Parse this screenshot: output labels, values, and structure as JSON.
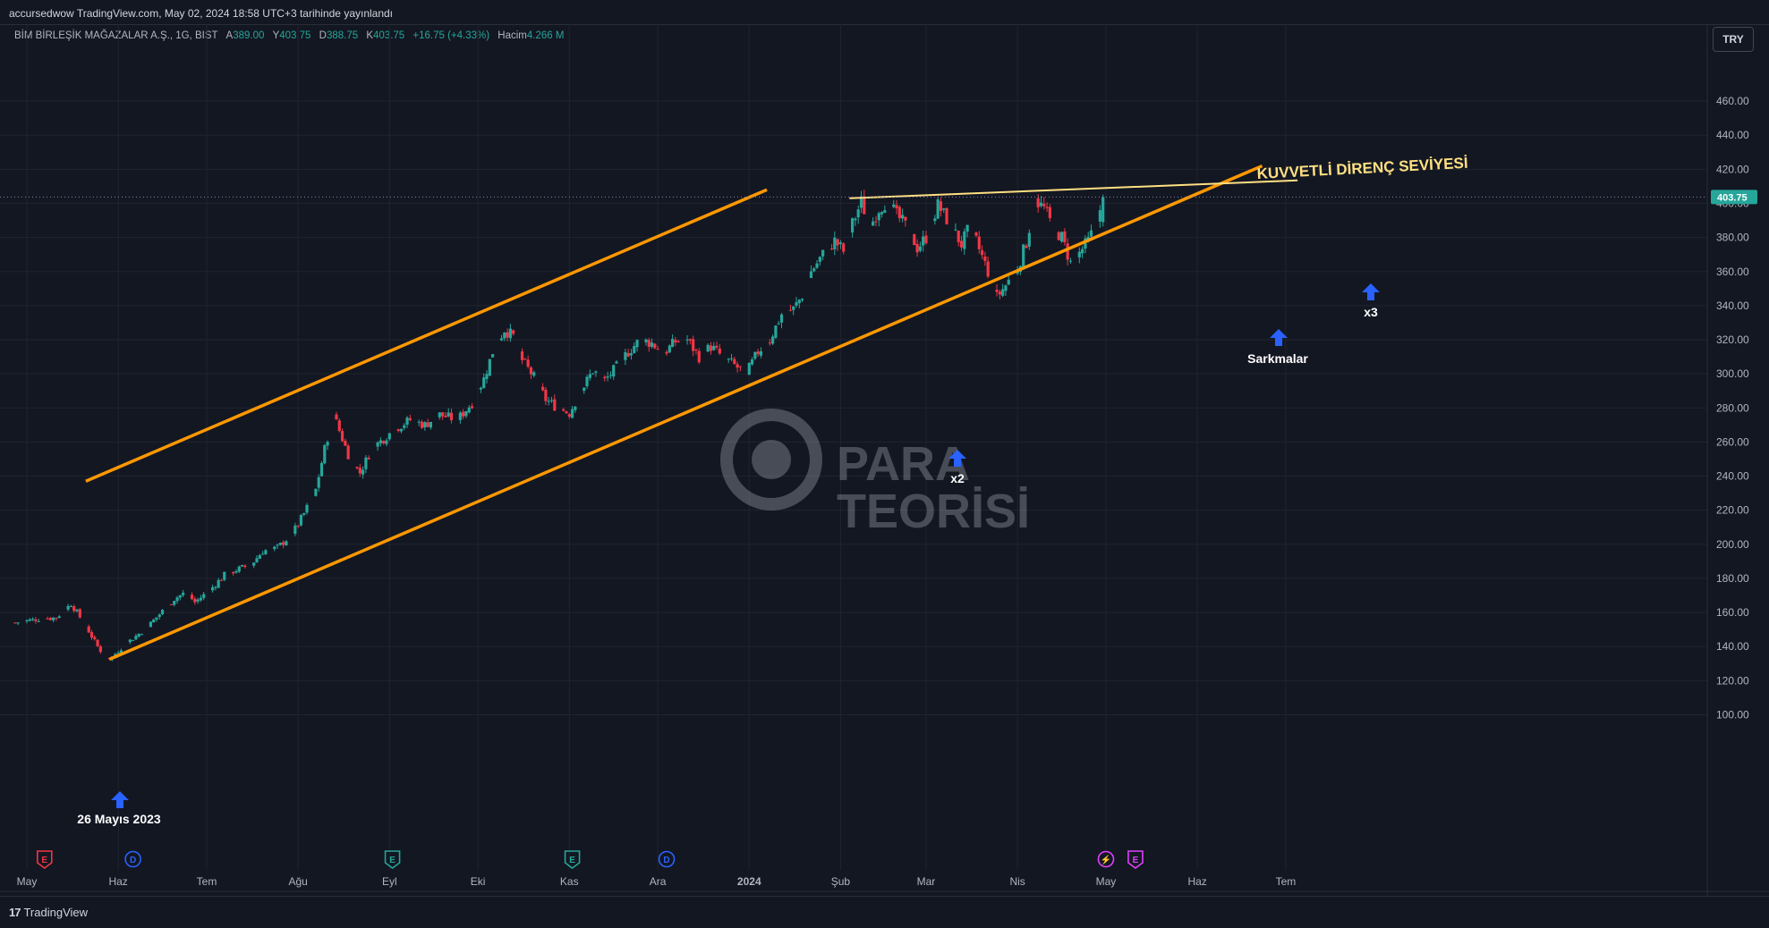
{
  "header": {
    "publish_line": "accursedwow TradingView.com, May 02, 2024 18:58 UTC+3 tarihinde yayınlandı",
    "symbol": "BİM BİRLEŞİK MAĞAZALAR A.Ş., 1G, BIST",
    "open_label": "A",
    "open_value": "389.00",
    "high_label": "Y",
    "high_value": "403.75",
    "low_label": "D",
    "low_value": "388.75",
    "close_label": "K",
    "close_value": "403.75",
    "change": "+16.75 (+4.33%)",
    "volume_label": "Hacim",
    "volume_value": "4.266 M",
    "currency": "TRY"
  },
  "footer": {
    "brand": "TradingView",
    "logo_glyph": "17"
  },
  "watermark": {
    "line1": "PARA",
    "line2": "TEORİSİ"
  },
  "colors": {
    "up": "#26a69a",
    "down": "#f23645",
    "channel": "#ff9800",
    "resistance": "#ffe082",
    "arrow": "#2962ff",
    "last_price": "#26a69a"
  },
  "chart_data": {
    "type": "candlestick",
    "ylim": [
      90,
      470
    ],
    "y_ticks": [
      100,
      120,
      140,
      160,
      180,
      200,
      220,
      240,
      260,
      280,
      300,
      320,
      340,
      360,
      380,
      400,
      420,
      440,
      460
    ],
    "y_tick_labels": [
      "100.00",
      "120.00",
      "140.00",
      "160.00",
      "180.00",
      "200.00",
      "220.00",
      "240.00",
      "260.00",
      "280.00",
      "300.00",
      "320.00",
      "340.00",
      "360.00",
      "380.00",
      "400.00",
      "420.00",
      "440.00",
      "460.00"
    ],
    "x_labels": [
      {
        "label": "May",
        "day": 0
      },
      {
        "label": "Haz",
        "day": 31
      },
      {
        "label": "Tem",
        "day": 61
      },
      {
        "label": "Ağu",
        "day": 92
      },
      {
        "label": "Eyl",
        "day": 123
      },
      {
        "label": "Eki",
        "day": 153
      },
      {
        "label": "Kas",
        "day": 184
      },
      {
        "label": "Ara",
        "day": 214
      },
      {
        "label": "2024",
        "day": 245
      },
      {
        "label": "Şub",
        "day": 276
      },
      {
        "label": "Mar",
        "day": 305
      },
      {
        "label": "Nis",
        "day": 336
      },
      {
        "label": "May",
        "day": 366
      },
      {
        "label": "Haz",
        "day": 397
      },
      {
        "label": "Tem",
        "day": 427
      }
    ],
    "last_price": "403.75",
    "approx_closes": [
      {
        "day": -4,
        "close": 154
      },
      {
        "day": 3,
        "close": 156
      },
      {
        "day": 10,
        "close": 157
      },
      {
        "day": 15,
        "close": 165
      },
      {
        "day": 17,
        "close": 160
      },
      {
        "day": 20,
        "close": 152
      },
      {
        "day": 24,
        "close": 140
      },
      {
        "day": 27,
        "close": 133
      },
      {
        "day": 29,
        "close": 134
      },
      {
        "day": 33,
        "close": 141
      },
      {
        "day": 40,
        "close": 150
      },
      {
        "day": 45,
        "close": 159
      },
      {
        "day": 50,
        "close": 168
      },
      {
        "day": 54,
        "close": 172
      },
      {
        "day": 57,
        "close": 166
      },
      {
        "day": 62,
        "close": 173
      },
      {
        "day": 67,
        "close": 182
      },
      {
        "day": 71,
        "close": 185
      },
      {
        "day": 76,
        "close": 188
      },
      {
        "day": 80,
        "close": 196
      },
      {
        "day": 85,
        "close": 198
      },
      {
        "day": 90,
        "close": 206
      },
      {
        "day": 94,
        "close": 218
      },
      {
        "day": 98,
        "close": 232
      },
      {
        "day": 101,
        "close": 256
      },
      {
        "day": 104,
        "close": 276
      },
      {
        "day": 107,
        "close": 262
      },
      {
        "day": 110,
        "close": 248
      },
      {
        "day": 113,
        "close": 242
      },
      {
        "day": 117,
        "close": 256
      },
      {
        "day": 121,
        "close": 262
      },
      {
        "day": 125,
        "close": 268
      },
      {
        "day": 130,
        "close": 273
      },
      {
        "day": 135,
        "close": 270
      },
      {
        "day": 140,
        "close": 276
      },
      {
        "day": 146,
        "close": 273
      },
      {
        "day": 151,
        "close": 283
      },
      {
        "day": 155,
        "close": 297
      },
      {
        "day": 158,
        "close": 313
      },
      {
        "day": 162,
        "close": 326
      },
      {
        "day": 165,
        "close": 322
      },
      {
        "day": 168,
        "close": 308
      },
      {
        "day": 172,
        "close": 298
      },
      {
        "day": 176,
        "close": 285
      },
      {
        "day": 180,
        "close": 280
      },
      {
        "day": 184,
        "close": 277
      },
      {
        "day": 188,
        "close": 290
      },
      {
        "day": 192,
        "close": 302
      },
      {
        "day": 196,
        "close": 296
      },
      {
        "day": 200,
        "close": 304
      },
      {
        "day": 204,
        "close": 313
      },
      {
        "day": 208,
        "close": 320
      },
      {
        "day": 212,
        "close": 318
      },
      {
        "day": 216,
        "close": 312
      },
      {
        "day": 220,
        "close": 319
      },
      {
        "day": 224,
        "close": 320
      },
      {
        "day": 228,
        "close": 310
      },
      {
        "day": 232,
        "close": 316
      },
      {
        "day": 236,
        "close": 310
      },
      {
        "day": 240,
        "close": 305
      },
      {
        "day": 244,
        "close": 300
      },
      {
        "day": 248,
        "close": 313
      },
      {
        "day": 252,
        "close": 320
      },
      {
        "day": 256,
        "close": 335
      },
      {
        "day": 260,
        "close": 338
      },
      {
        "day": 263,
        "close": 346
      },
      {
        "day": 266,
        "close": 360
      },
      {
        "day": 270,
        "close": 370
      },
      {
        "day": 274,
        "close": 378
      },
      {
        "day": 277,
        "close": 372
      },
      {
        "day": 280,
        "close": 388
      },
      {
        "day": 283,
        "close": 401
      },
      {
        "day": 286,
        "close": 386
      },
      {
        "day": 289,
        "close": 397
      },
      {
        "day": 292,
        "close": 402
      },
      {
        "day": 295,
        "close": 393
      },
      {
        "day": 299,
        "close": 385
      },
      {
        "day": 302,
        "close": 374
      },
      {
        "day": 305,
        "close": 380
      },
      {
        "day": 309,
        "close": 399
      },
      {
        "day": 313,
        "close": 388
      },
      {
        "day": 317,
        "close": 376
      },
      {
        "day": 320,
        "close": 387
      },
      {
        "day": 323,
        "close": 373
      },
      {
        "day": 326,
        "close": 360
      },
      {
        "day": 329,
        "close": 345
      },
      {
        "day": 332,
        "close": 352
      },
      {
        "day": 336,
        "close": 362
      },
      {
        "day": 339,
        "close": 377
      },
      {
        "day": 342,
        "close": 402
      },
      {
        "day": 345,
        "close": 397
      },
      {
        "day": 348,
        "close": 386
      },
      {
        "day": 351,
        "close": 380
      },
      {
        "day": 354,
        "close": 365
      },
      {
        "day": 357,
        "close": 371
      },
      {
        "day": 360,
        "close": 378
      },
      {
        "day": 363,
        "close": 389
      },
      {
        "day": 365,
        "close": 403.75
      }
    ],
    "annotations": {
      "resistance_label": "KUVVETLİ DİRENÇ SEVİYESİ",
      "dip_label": "26 Mayıs 2023",
      "touch2_label": "x2",
      "sag_label": "Sarkmalar",
      "touch3_label": "x3"
    },
    "lines": {
      "channel_upper": [
        [
          20,
          237
        ],
        [
          251,
          408
        ]
      ],
      "channel_lower": [
        [
          28,
          132.5
        ],
        [
          419,
          422
        ]
      ],
      "resistance": [
        [
          279,
          403
        ],
        [
          431,
          413.5
        ]
      ]
    },
    "markers": [
      {
        "letter": "E",
        "day": 6,
        "color": "#f23645"
      },
      {
        "letter": "D",
        "day": 36,
        "color": "#2962ff"
      },
      {
        "letter": "E",
        "day": 124,
        "color": "#26a69a"
      },
      {
        "letter": "E",
        "day": 185,
        "color": "#26a69a"
      },
      {
        "letter": "D",
        "day": 217,
        "color": "#2962ff"
      },
      {
        "letter": "⚡",
        "day": 366,
        "color": "#e040fb"
      },
      {
        "letter": "E",
        "day": 376,
        "color": "#e040fb"
      }
    ]
  }
}
